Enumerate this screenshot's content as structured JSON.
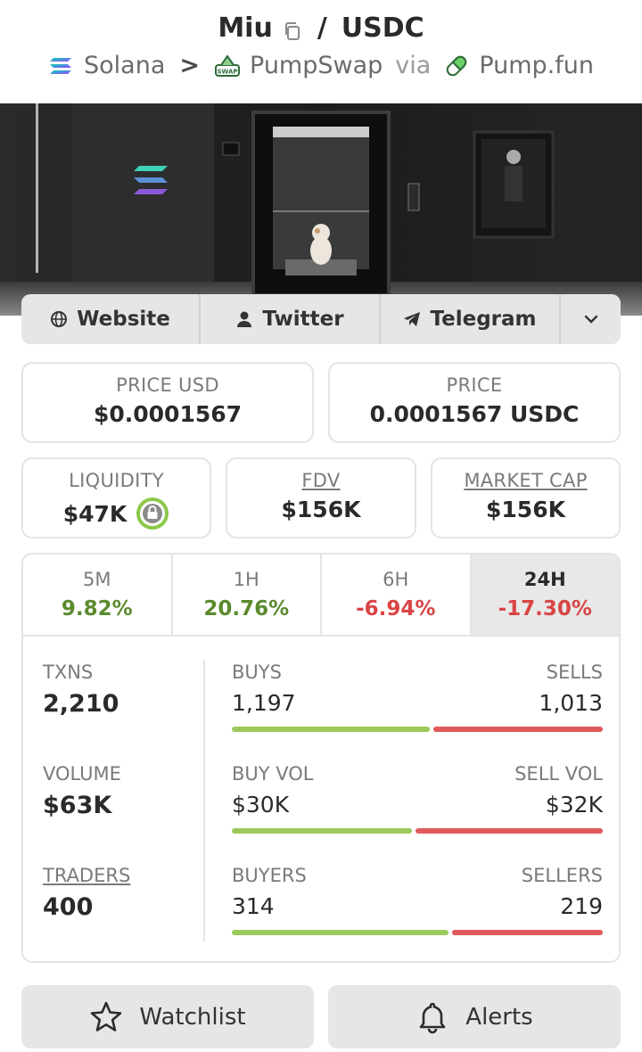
{
  "header": {
    "token": "Miu",
    "slash": "/",
    "quote": "USDC",
    "chain": "Solana",
    "sep": ">",
    "dex": "PumpSwap",
    "via": "via",
    "launchpad": "Pump.fun"
  },
  "links": {
    "website": "Website",
    "twitter": "Twitter",
    "telegram": "Telegram"
  },
  "price": {
    "usd_label": "PRICE USD",
    "usd_value": "$0.0001567",
    "native_label": "PRICE",
    "native_value": "0.0001567 USDC"
  },
  "metrics": {
    "liquidity_label": "LIQUIDITY",
    "liquidity_value": "$47K",
    "fdv_label": "FDV",
    "fdv_value": "$156K",
    "mcap_label": "MARKET CAP",
    "mcap_value": "$156K"
  },
  "tabs": [
    {
      "label": "5M",
      "value": "9.82%"
    },
    {
      "label": "1H",
      "value": "20.76%"
    },
    {
      "label": "6H",
      "value": "-6.94%"
    },
    {
      "label": "24H",
      "value": "-17.30%"
    }
  ],
  "active_tab": "24H",
  "stats": {
    "txns_label": "TXNS",
    "txns_value": "2,210",
    "volume_label": "VOLUME",
    "volume_value": "$63K",
    "traders_label": "TRADERS",
    "traders_value": "400",
    "buys_label": "BUYS",
    "buys_value": "1,197",
    "sells_label": "SELLS",
    "sells_value": "1,013",
    "buyvol_label": "BUY VOL",
    "buyvol_value": "$30K",
    "sellvol_label": "SELL VOL",
    "sellvol_value": "$32K",
    "buyers_label": "BUYERS",
    "buyers_value": "314",
    "sellers_label": "SELLERS",
    "sellers_value": "219"
  },
  "bars": {
    "buys_fraction": 0.54,
    "buyvol_fraction": 0.49,
    "buyers_fraction": 0.59
  },
  "actions": {
    "watchlist": "Watchlist",
    "alerts": "Alerts"
  },
  "colors": {
    "positive": "#5b8a2e",
    "negative": "#d94545",
    "buy_bar": "#9cc95b",
    "sell_bar": "#e05a5a"
  },
  "icons": [
    "copy-icon",
    "solana-icon",
    "pumpswap-icon",
    "pumpfun-pill-icon",
    "globe-icon",
    "user-icon",
    "paper-plane-icon",
    "chevron-down-icon",
    "lock-icon",
    "star-icon",
    "bell-icon"
  ]
}
